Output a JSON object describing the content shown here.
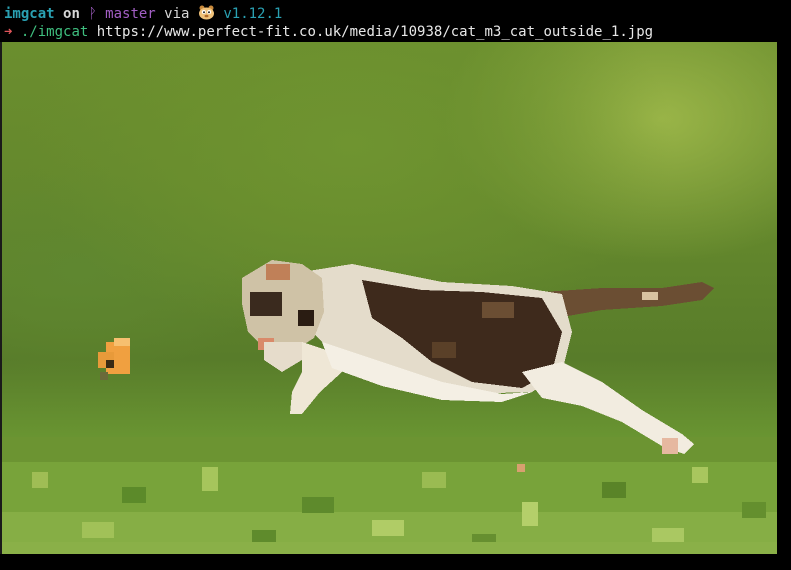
{
  "prompt": {
    "directory": "imgcat",
    "on": "on",
    "branch_symbol": "ᚹ",
    "branch": "master",
    "via": "via",
    "toolchain_icon": "gopher-icon",
    "version": "v1.12.1"
  },
  "command": {
    "arrow": "➜",
    "program": "./imgcat",
    "argument": "https://www.perfect-fit.co.uk/media/10938/cat_m3_cat_outside_1.jpg"
  },
  "colors": {
    "background": "#000000",
    "directory": "#2aa1b3",
    "branch": "#a35fc5",
    "arrow": "#e0555a",
    "command": "#3fbf7f"
  },
  "image": {
    "description_icon": "cat-image"
  }
}
